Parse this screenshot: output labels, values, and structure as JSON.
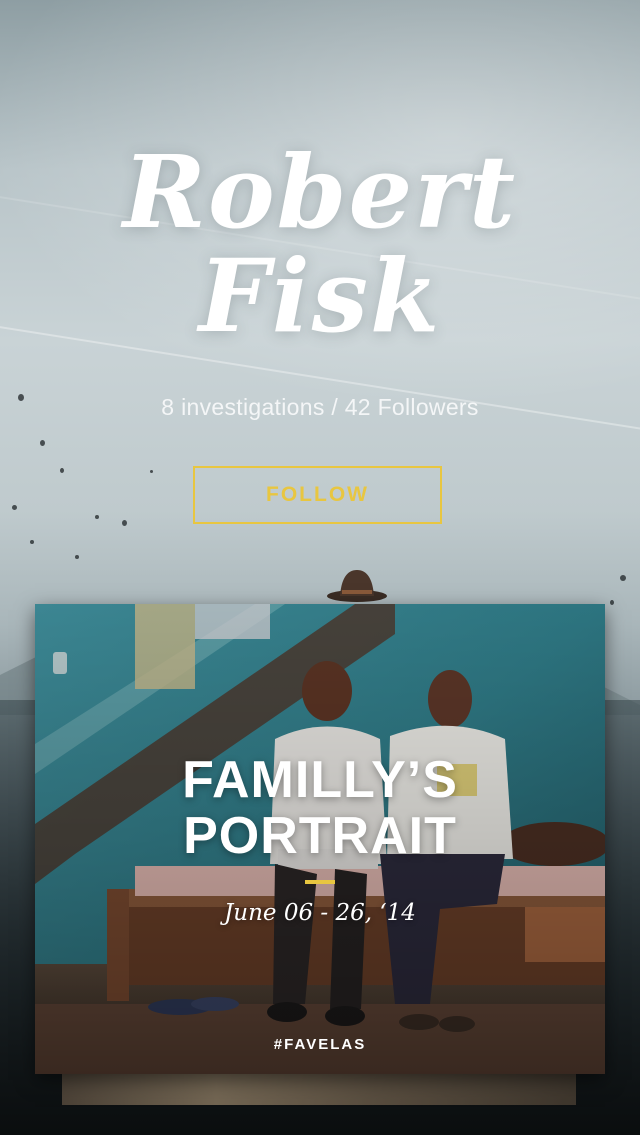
{
  "profile": {
    "name_line1": "Robert",
    "name_line2": "Fisk",
    "stats": "8 investigations / 42 Followers",
    "follow_label": "FOLLOW"
  },
  "card": {
    "title_line1": "FAMILLY’S",
    "title_line2": "PORTRAIT",
    "date": "June 06 - 26, ‘14",
    "tag": "#FAVELAS"
  },
  "colors": {
    "accent": "#e8c640",
    "text": "#ffffff"
  }
}
